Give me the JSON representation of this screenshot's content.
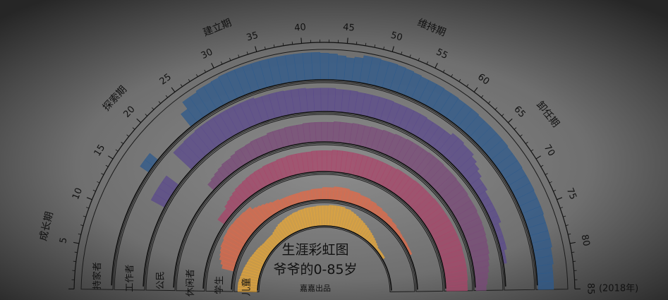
{
  "chart_data": {
    "type": "radial-bar",
    "title": "生涯彩虹图",
    "subtitle": "爷爷的0-85岁",
    "credit": "嘉嘉出品",
    "age_axis": {
      "min": 0,
      "max": 85,
      "major_step": 5,
      "ticks": [
        "5",
        "10",
        "15",
        "20",
        "25",
        "30",
        "35",
        "40",
        "45",
        "50",
        "55",
        "60",
        "65",
        "70",
        "75",
        "80",
        "85"
      ],
      "end_note": "(2018年)"
    },
    "stages": [
      {
        "label": "成长期",
        "age": 6
      },
      {
        "label": "探索期",
        "age": 20
      },
      {
        "label": "建立期",
        "age": 32
      },
      {
        "label": "维持期",
        "age": 53
      },
      {
        "label": "卸任期",
        "age": 67
      }
    ],
    "ages": [
      0,
      1,
      2,
      3,
      4,
      5,
      6,
      7,
      8,
      9,
      10,
      11,
      12,
      13,
      14,
      15,
      16,
      17,
      18,
      19,
      20,
      21,
      22,
      23,
      24,
      25,
      26,
      27,
      28,
      29,
      30,
      31,
      32,
      33,
      34,
      35,
      36,
      37,
      38,
      39,
      40,
      41,
      42,
      43,
      44,
      45,
      46,
      47,
      48,
      49,
      50,
      51,
      52,
      53,
      54,
      55,
      56,
      57,
      58,
      59,
      60,
      61,
      62,
      63,
      64,
      65,
      66,
      67,
      68,
      69,
      70,
      71,
      72,
      73,
      74,
      75,
      76,
      77,
      78,
      79,
      80,
      81,
      82,
      83,
      84,
      85
    ],
    "value_max": 1.0,
    "series": [
      {
        "name": "持家者",
        "color": "#2d5a8c",
        "values": [
          0,
          0,
          0,
          0,
          0,
          0,
          0,
          0,
          0,
          0,
          0,
          0,
          0,
          0,
          0,
          0,
          0.35,
          0.35,
          0,
          0,
          0,
          0,
          0,
          0,
          0.55,
          0.85,
          0.85,
          0.9,
          0.9,
          0.92,
          0.95,
          0.95,
          0.95,
          0.95,
          0.95,
          0.95,
          0.95,
          0.95,
          0.95,
          0.95,
          0.95,
          0.95,
          0.92,
          0.9,
          0.85,
          0.8,
          0.85,
          0.95,
          0.95,
          0.92,
          0.92,
          0.9,
          0.88,
          0.85,
          0.82,
          0.82,
          0.82,
          0.8,
          0.8,
          0.78,
          0.78,
          0.78,
          0.75,
          0.75,
          0.75,
          0.75,
          0.75,
          0.72,
          0.72,
          0.72,
          0.7,
          0.7,
          0.7,
          0.68,
          0.68,
          0.68,
          0.65,
          0.65,
          0.65,
          0.65,
          0.6,
          0.6,
          0.55,
          0.55,
          0.55,
          0.5
        ]
      },
      {
        "name": "工作者",
        "color": "#5b4a8c",
        "values": [
          0,
          0,
          0,
          0,
          0,
          0,
          0,
          0,
          0,
          0,
          0,
          0,
          0,
          0.55,
          0.55,
          0.55,
          0.55,
          0,
          0,
          0,
          0.9,
          0.9,
          0.92,
          0.92,
          0.95,
          0.95,
          0.95,
          0.95,
          0.95,
          0.95,
          0.95,
          0.95,
          0.95,
          0.9,
          0.9,
          0.9,
          0.9,
          0.88,
          0.88,
          0.88,
          0.85,
          0.85,
          0.85,
          0.85,
          0.82,
          0.82,
          0.82,
          0.8,
          0.8,
          0.8,
          0.8,
          0.8,
          0.78,
          0.78,
          0.78,
          0.78,
          0.78,
          0.75,
          0.75,
          0.75,
          0.75,
          0.85,
          0.85,
          0.8,
          0.8,
          0.7,
          0.6,
          0.5,
          0.4,
          0.4,
          0.3,
          0.3,
          0.3,
          0.3,
          0.3,
          0.2,
          0.2,
          0.2,
          0.2,
          0.1,
          0.1,
          0,
          0,
          0,
          0,
          0
        ]
      },
      {
        "name": "公民",
        "color": "#7a4a78",
        "values": [
          0,
          0,
          0,
          0,
          0,
          0,
          0,
          0,
          0,
          0,
          0,
          0,
          0,
          0,
          0,
          0,
          0,
          0,
          0,
          0,
          0.3,
          0.35,
          0.4,
          0.45,
          0.5,
          0.5,
          0.55,
          0.6,
          0.6,
          0.62,
          0.65,
          0.65,
          0.65,
          0.7,
          0.7,
          0.7,
          0.72,
          0.72,
          0.72,
          0.75,
          0.75,
          0.75,
          0.75,
          0.75,
          0.78,
          0.78,
          0.78,
          0.8,
          0.8,
          0.8,
          0.82,
          0.82,
          0.85,
          0.85,
          0.88,
          0.88,
          0.9,
          0.9,
          0.9,
          0.9,
          0.92,
          0.92,
          0.92,
          0.9,
          0.9,
          0.9,
          0.88,
          0.88,
          0.88,
          0.85,
          0.85,
          0.85,
          0.82,
          0.82,
          0.8,
          0.78,
          0.75,
          0.72,
          0.7,
          0.65,
          0.6,
          0.55,
          0.5,
          0.45,
          0.4,
          0.35
        ]
      },
      {
        "name": "休闲者",
        "color": "#a8466a",
        "values": [
          0,
          0,
          0,
          0,
          0,
          0,
          0,
          0,
          0,
          0,
          0,
          0,
          0,
          0,
          0,
          0,
          0.3,
          0.3,
          0.3,
          0.4,
          0.45,
          0.5,
          0.55,
          0.6,
          0.62,
          0.65,
          0.68,
          0.7,
          0.72,
          0.72,
          0.75,
          0.75,
          0.75,
          0.78,
          0.78,
          0.8,
          0.8,
          0.8,
          0.8,
          0.8,
          0.82,
          0.82,
          0.82,
          0.82,
          0.85,
          0.85,
          0.85,
          0.85,
          0.85,
          0.85,
          0.85,
          0.85,
          0.85,
          0.85,
          0.85,
          0.85,
          0.85,
          0.88,
          0.88,
          0.88,
          0.88,
          0.9,
          0.9,
          0.9,
          0.9,
          0.9,
          0.92,
          0.92,
          0.92,
          0.92,
          0.92,
          0.92,
          0.92,
          0.92,
          0.92,
          0.92,
          0.92,
          0.9,
          0.9,
          0.9,
          0.9,
          0.88,
          0.88,
          0.85,
          0.85,
          0.85
        ]
      },
      {
        "name": "学生",
        "color": "#e06b4a",
        "values": [
          0,
          0,
          0,
          0,
          0,
          0,
          0.5,
          0.6,
          0.7,
          0.75,
          0.8,
          0.85,
          0.85,
          0.9,
          0.9,
          0.92,
          0.92,
          0.9,
          0.9,
          0.88,
          0.88,
          0.85,
          0.85,
          0.7,
          0.65,
          0.6,
          0.55,
          0.5,
          0.45,
          0.45,
          0.4,
          0.4,
          0.4,
          0.4,
          0.4,
          0.4,
          0.42,
          0.42,
          0.42,
          0.45,
          0.45,
          0.45,
          0.5,
          0.5,
          0.5,
          0.55,
          0.55,
          0.55,
          0.55,
          0.5,
          0.5,
          0.5,
          0.45,
          0.45,
          0.45,
          0.4,
          0.4,
          0.35,
          0.35,
          0.3,
          0.3,
          0.25,
          0.25,
          0.2,
          0.2,
          0.15,
          0.15,
          0.12,
          0.1,
          0.1,
          0.1,
          0.08,
          0.08,
          0.08,
          0,
          0,
          0,
          0,
          0,
          0,
          0,
          0,
          0,
          0,
          0,
          0
        ]
      },
      {
        "name": "儿童",
        "color": "#e8a83a",
        "values": [
          0.9,
          0.9,
          0.9,
          0.88,
          0.85,
          0.82,
          0.8,
          0.78,
          0.75,
          0.72,
          0.7,
          0.68,
          0.65,
          0.62,
          0.6,
          0.58,
          0.55,
          0.52,
          0.5,
          0.5,
          0.5,
          0.5,
          0.5,
          0.55,
          0.6,
          0.65,
          0.7,
          0.72,
          0.75,
          0.78,
          0.8,
          0.82,
          0.85,
          0.85,
          0.88,
          0.88,
          0.9,
          0.9,
          0.9,
          0.9,
          0.92,
          0.92,
          0.92,
          0.92,
          0.95,
          0.95,
          0.95,
          0.95,
          0.95,
          0.9,
          0.9,
          0.85,
          0.8,
          0.75,
          0.7,
          0.65,
          0.6,
          0.55,
          0.5,
          0.45,
          0.4,
          0.35,
          0.3,
          0.25,
          0.2,
          0.15,
          0.1,
          0.1,
          0.1,
          0.1,
          0.1,
          0,
          0,
          0,
          0,
          0,
          0,
          0,
          0,
          0,
          0,
          0,
          0,
          0,
          0,
          0
        ]
      }
    ],
    "background_color": "#7f7f7f",
    "vignette_color": "#1a1a1a"
  }
}
